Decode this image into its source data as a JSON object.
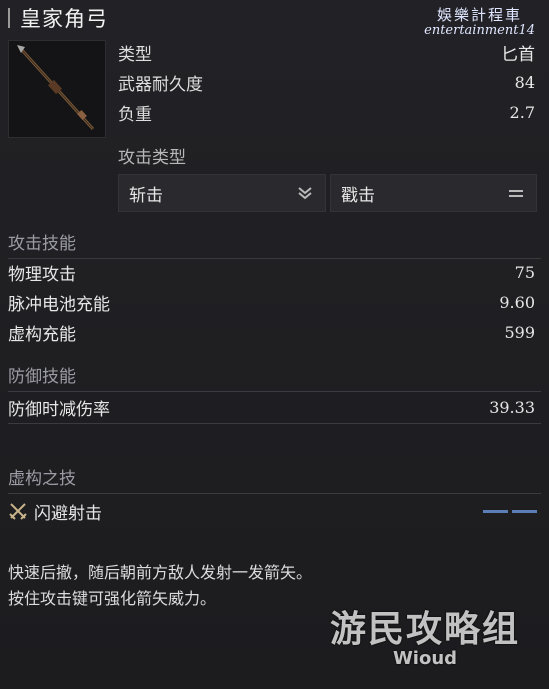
{
  "item": {
    "name": "皇家角弓",
    "type_label": "类型",
    "type_value": "匕首",
    "durability_label": "武器耐久度",
    "durability_value": "84",
    "weight_label": "负重",
    "weight_value": "2.7"
  },
  "attack_type": {
    "label": "攻击类型",
    "option1": "斩击",
    "option2": "戳击"
  },
  "attack_skills": {
    "heading": "攻击技能",
    "rows": [
      {
        "label": "物理攻击",
        "value": "75"
      },
      {
        "label": "脉冲电池充能",
        "value": "9.60"
      },
      {
        "label": "虚构充能",
        "value": "599"
      }
    ]
  },
  "defense_skills": {
    "heading": "防御技能",
    "rows": [
      {
        "label": "防御时减伤率",
        "value": "39.33"
      }
    ]
  },
  "fable_skill": {
    "heading": "虚构之技",
    "name": "闪避射击",
    "icon": "crossed-swords-icon"
  },
  "description": {
    "line1": "快速后撤，随后朝前方敌人发射一发箭矢。",
    "line2": "按住攻击键可强化箭矢威力。"
  },
  "watermark_top": {
    "line1": "娛樂計程車",
    "line2": "entertainment14"
  },
  "watermark_bottom": {
    "cn": "游民攻略组",
    "en": "Wioud"
  },
  "colors": {
    "background": "#1d1d20",
    "accent_bar": "#5b7eb6"
  }
}
